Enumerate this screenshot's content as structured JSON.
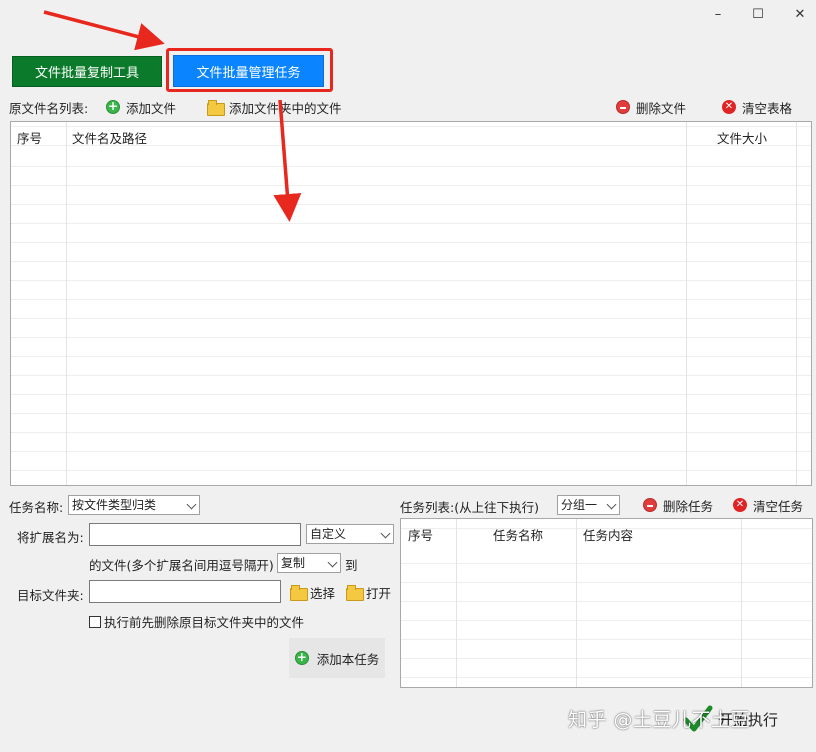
{
  "window": {
    "minimize": "–",
    "maximize": "☐",
    "close": "✕"
  },
  "tabs": [
    {
      "label": "文件批量复制工具"
    },
    {
      "label": "文件批量管理任务"
    }
  ],
  "toolbar": {
    "source_list_label": "原文件名列表:",
    "add_file": "添加文件",
    "add_folder_files": "添加文件夹中的文件",
    "delete_file": "删除文件",
    "clear_table": "清空表格"
  },
  "file_table": {
    "columns": [
      "序号",
      "文件名及路径",
      "文件大小"
    ]
  },
  "task_form": {
    "task_name_label": "任务名称:",
    "task_name_value": "按文件类型归类",
    "ext_label": "将扩展名为:",
    "ext_value": "",
    "ext_mode": "自定义",
    "ext_hint": "的文件(多个扩展名间用逗号隔开)",
    "action_value": "复制",
    "to_label": "到",
    "target_label": "目标文件夹:",
    "target_value": "",
    "choose_label": "选择",
    "open_label": "打开",
    "pre_delete_label": "执行前先删除原目标文件夹中的文件",
    "add_task_label": "添加本任务"
  },
  "task_list": {
    "label": "任务列表:(从上往下执行)",
    "group_value": "分组一",
    "delete_task": "删除任务",
    "clear_tasks": "清空任务",
    "columns": [
      "序号",
      "任务名称",
      "任务内容"
    ]
  },
  "footer": {
    "start_label": "开始执行",
    "watermark": "知乎 @土豆儿不土豆"
  },
  "colors": {
    "tab_green": "#0b7a2a",
    "tab_blue": "#0a84ff",
    "annotation_red": "#e8281e"
  }
}
